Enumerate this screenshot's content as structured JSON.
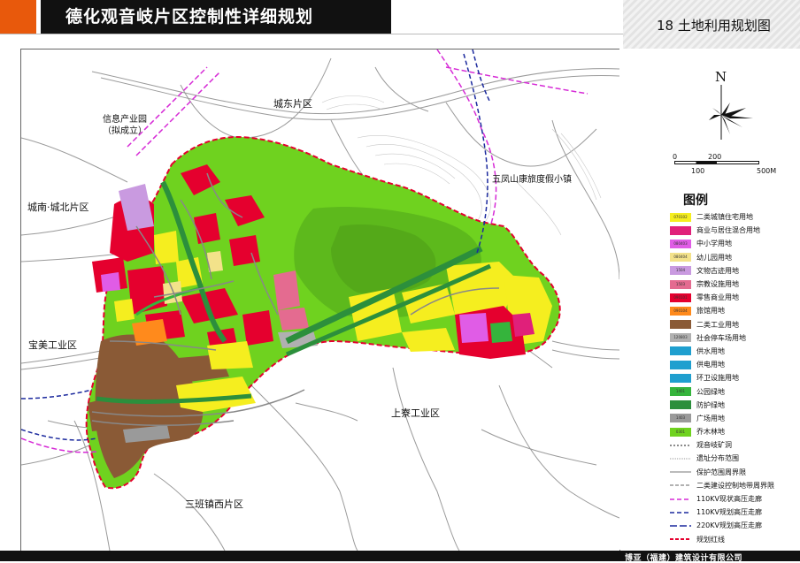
{
  "header": {
    "title": "德化观音岐片区控制性详细规划",
    "sheet_title": "18  土地利用规划图"
  },
  "map": {
    "labels": {
      "xinxi": "信息产业园",
      "nicheng": "（拟成立）",
      "chengdong": "城东片区",
      "wufeng": "五凤山康旅度假小镇",
      "chengnan": "城南·城北片区",
      "baomei": "宝美工业区",
      "shangliao": "上寮工业区",
      "sanban": "三班镇西片区"
    }
  },
  "compass": {
    "north": "N",
    "scale_0": "0",
    "scale_200": "200",
    "scale_100": "100",
    "scale_500": "500M"
  },
  "legend": {
    "title": "图例",
    "items": [
      {
        "code": "070102",
        "name": "二类城镇住宅用地",
        "color": "#f5ee1f"
      },
      {
        "code": "",
        "name": "商业与居住混合用地",
        "color": "#e0207a"
      },
      {
        "code": "080403",
        "name": "中小学用地",
        "color": "#e05ce6"
      },
      {
        "code": "080404",
        "name": "幼儿园用地",
        "color": "#f3e28a"
      },
      {
        "code": "1504",
        "name": "文物古迹用地",
        "color": "#c99ae0"
      },
      {
        "code": "1503",
        "name": "宗教设施用地",
        "color": "#e46b90"
      },
      {
        "code": "090101",
        "name": "零售商业用地",
        "color": "#e5002e"
      },
      {
        "code": "090104",
        "name": "旅馆用地",
        "color": "#ff8a1c"
      },
      {
        "code": "",
        "name": "二类工业用地",
        "color": "#8a5a36"
      },
      {
        "code": "120803",
        "name": "社会停车场用地",
        "color": "#b0b0b0"
      },
      {
        "code": "",
        "name": "供水用地",
        "color": "#1f9fcf"
      },
      {
        "code": "",
        "name": "供电用地",
        "color": "#1f9fcf"
      },
      {
        "code": "",
        "name": "环卫设施用地",
        "color": "#1f9fcf"
      },
      {
        "code": "1401",
        "name": "公园绿地",
        "color": "#35b43c"
      },
      {
        "code": "",
        "name": "防护绿地",
        "color": "#2c8f3c"
      },
      {
        "code": "1403",
        "name": "广场用地",
        "color": "#9a9a9a"
      },
      {
        "code": "0301",
        "name": "乔木林地",
        "color": "#6fd21f"
      },
      {
        "code": "",
        "name": "观音岐矿洞",
        "color": "#ffffff"
      },
      {
        "code": "",
        "name": "遗址分布范围",
        "color": "#ffffff"
      },
      {
        "code": "",
        "name": "保护范围周界限",
        "color": "#ffffff"
      },
      {
        "code": "",
        "name": "二类建设控制地带周界限",
        "color": "#ffffff"
      },
      {
        "code": "",
        "name": "110KV现状高压走廊",
        "color": "#ffffff"
      },
      {
        "code": "",
        "name": "110KV规划高压走廊",
        "color": "#ffffff"
      },
      {
        "code": "",
        "name": "220KV规划高压走廊",
        "color": "#ffffff"
      },
      {
        "code": "",
        "name": "规划红线",
        "color": "#ffffff"
      }
    ]
  },
  "footer": {
    "company": "博亚（福建）建筑设计有限公司"
  }
}
